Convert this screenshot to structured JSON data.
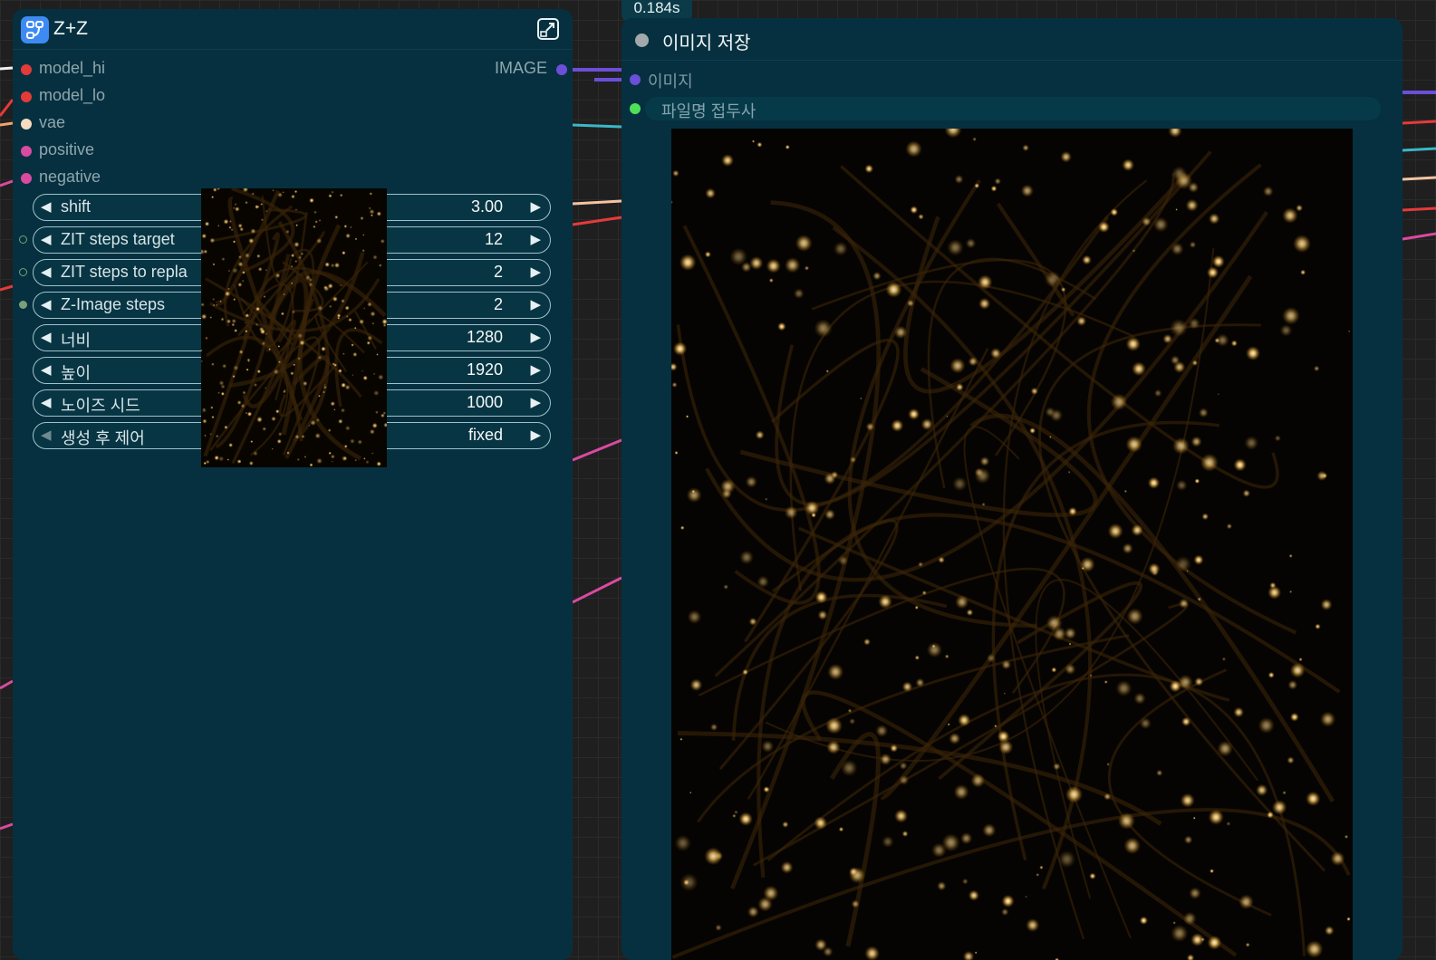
{
  "zz_node": {
    "title": "Z+Z",
    "inputs": [
      {
        "label": "model_hi",
        "color": "#e53a3a"
      },
      {
        "label": "model_lo",
        "color": "#e53a3a"
      },
      {
        "label": "vae",
        "color": "#f5dcc0"
      },
      {
        "label": "positive",
        "color": "#d94aa0"
      },
      {
        "label": "negative",
        "color": "#d94aa0"
      }
    ],
    "output": {
      "label": "IMAGE",
      "color": "#6b4fd8"
    },
    "widgets": [
      {
        "label": "shift",
        "value": "3.00"
      },
      {
        "label": "ZIT steps target",
        "value": "12"
      },
      {
        "label": "ZIT steps to repla",
        "value": "2"
      },
      {
        "label": "Z-Image steps",
        "value": "2"
      },
      {
        "label": "너비",
        "value": "1280"
      },
      {
        "label": "높이",
        "value": "1920"
      },
      {
        "label": "노이즈 시드",
        "value": "1000"
      },
      {
        "label": "생성 후 제어",
        "value": "fixed"
      }
    ],
    "preview_icon": "generated-image-thumbnail"
  },
  "timing": "0.184s",
  "save_node": {
    "title": "이미지 저장",
    "input_label": "이미지",
    "input_color": "#6b4fd8",
    "prefix_label": "파일명 접두사",
    "prefix_dot_color": "#4de15a",
    "preview_icon": "saved-image-preview"
  },
  "colors": {
    "node_bg": "#06303f",
    "canvas_bg": "#1f1f1f",
    "accent": "#3d8bf2"
  }
}
